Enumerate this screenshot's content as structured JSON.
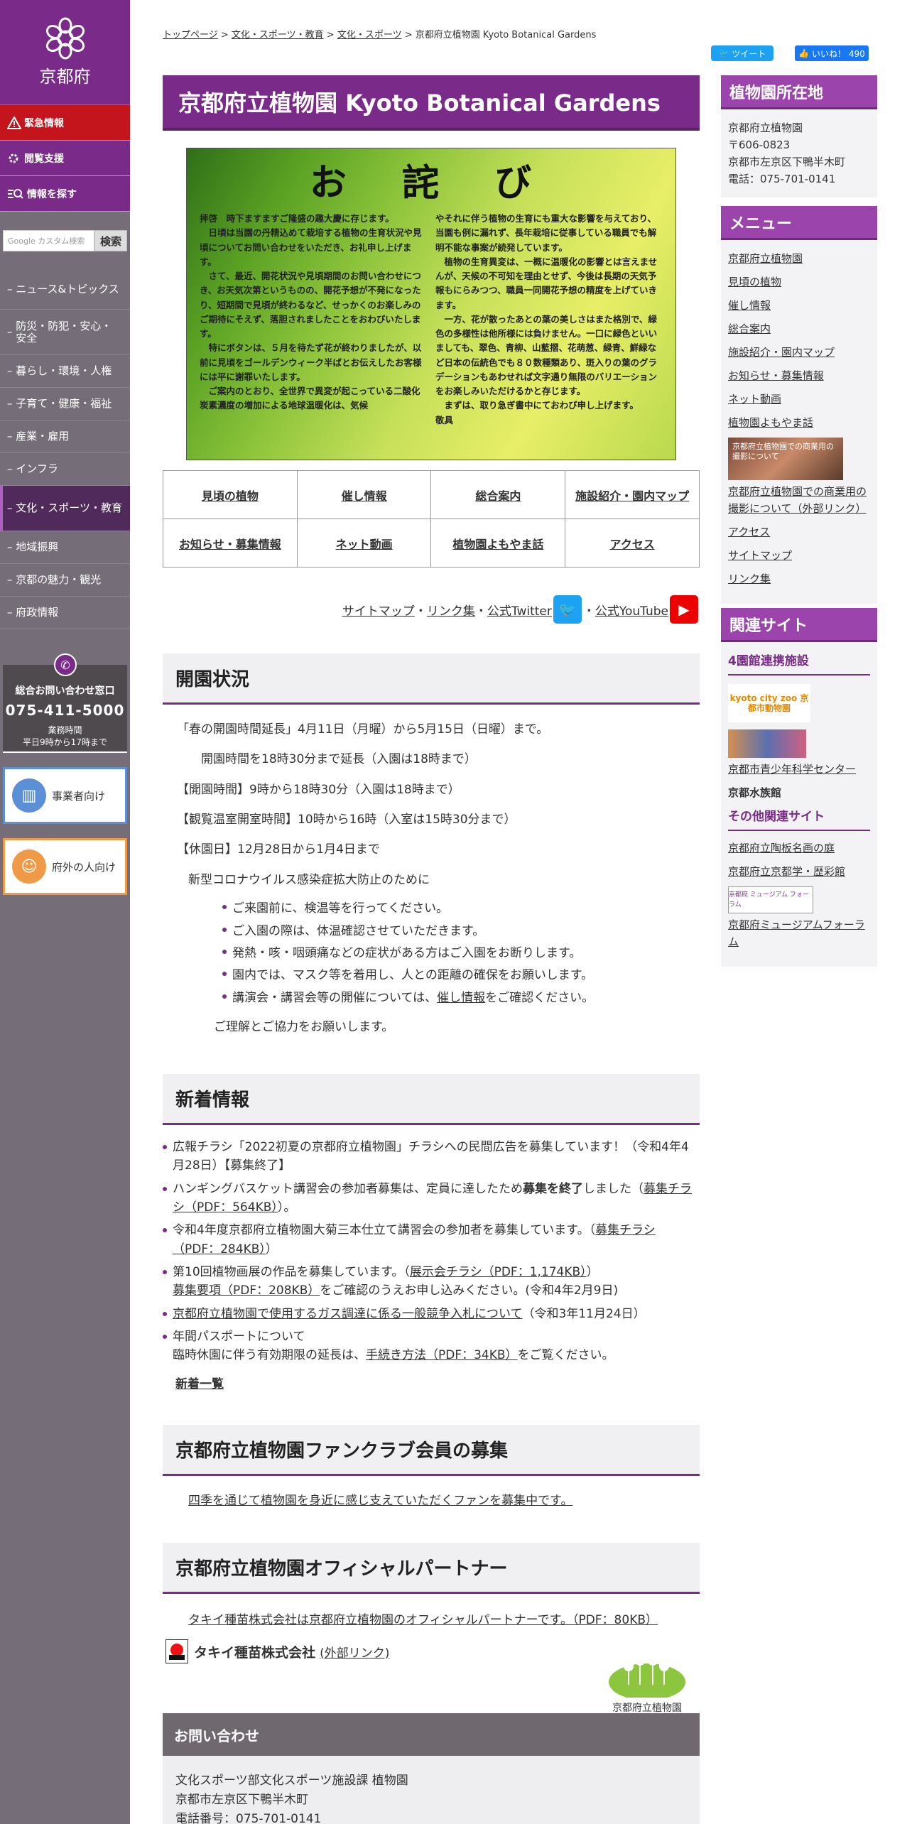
{
  "left": {
    "logo_text": "京都府",
    "emergency": "緊急情報",
    "reading": "閲覧支援",
    "find": "情報を探す",
    "search_placeholder": "Google カスタム検索",
    "search_btn": "検索",
    "nav": [
      "ニュース&トピックス",
      "防災・防犯・安心・安全",
      "暮らし・環境・人権",
      "子育て・健康・福祉",
      "産業・雇用",
      "インフラ",
      "文化・スポーツ・教育",
      "地域振興",
      "京都の魅力・観光",
      "府政情報"
    ],
    "contact": {
      "title": "総合お問い合わせ窓口",
      "phone": "075-411-5000",
      "hours_label": "業務時間",
      "hours": "平日9時から17時まで"
    },
    "card1": "事業者向け",
    "card2": "府外の人向け"
  },
  "breadcrumb": [
    "トップページ",
    "文化・スポーツ・教育",
    "文化・スポーツ",
    "京都府立植物園 Kyoto Botanical Gardens"
  ],
  "social": {
    "tweet": "ツイート",
    "like": "いいね！ 490"
  },
  "title": "京都府立植物園 Kyoto Botanical Gardens",
  "banner": {
    "heading": "お 詫 び",
    "left": "拝啓　時下ますますご隆盛の趣大慶に存じます。\n　日頃は当園の丹精込めて栽培する植物の生育状況や見頃についてお問い合わせをいただき、お礼申し上げます。\n　さて、最近、開花状況や見頃期間のお問い合わせにつき、お天気次第というものの、開花予想が不発になったり、短期間で見頃が終わるなど、せっかくのお楽しみのご期待にそえず、落胆されましたことをおわびいたします。\n　特にボタンは、５月を待たず花が終わりましたが、以前に見頃をゴールデンウィーク半ばとお伝えしたお客様には平に謝罪いたします。\n　ご案内のとおり、全世界で異変が起こっている二酸化炭素濃度の増加による地球温暖化は、気候",
    "right": "やそれに伴う植物の生育にも重大な影響を与えており、当園も例に漏れず、長年栽培に従事している職員でも解明不能な事案が続発しています。\n　植物の生育異変は、一概に温暖化の影響とは言えませんが、天候の不可知を理由とせず、今後は長期の天気予報もにらみつつ、職員一同開花予想の精度を上げていきます。\n　一方、花が散ったあとの葉の美しさはまた格別で、緑色の多様性は他所様には負けません。一口に緑色といいましても、翠色、青柳、山藍摺、花萌葱、緑青、鮮緑など日本の伝統色でも８０数種類あり、斑入りの葉のグラデーションもあわせれば文字通り無限のバリエーションをお楽しみいただけるかと存じます。\n　まずは、取り急ぎ書中にておわび申し上げます。\n敬具"
  },
  "grid": [
    "見頃の植物",
    "催し情報",
    "総合案内",
    "施設紹介・園内マップ",
    "お知らせ・募集情報",
    "ネット動画",
    "植物園よもやま話",
    "アクセス"
  ],
  "links": {
    "sitemap": "サイトマップ",
    "linkshu": "リンク集",
    "twitter": "公式Twitter",
    "youtube": "公式YouTube",
    "dot": "・"
  },
  "open": {
    "heading": "開園状況",
    "p1": "「春の開園時間延長」4月11日（月曜）から5月15日（日曜）まで。",
    "p2": "開園時間を18時30分まで延長（入園は18時まで）",
    "p3": "【開園時間】9時から18時30分（入園は18時まで）",
    "p4": "【観覧温室開室時間】10時から16時（入室は15時30分まで）",
    "p5": "【休園日】12月28日から1月4日まで",
    "p6": "新型コロナウイルス感染症拡大防止のために",
    "bullets": [
      "ご来園前に、検温等を行ってください。",
      "ご入園の際は、体温確認させていただきます。",
      "発熱・咳・咽頭痛などの症状がある方はご入園をお断りします。",
      "園内では、マスク等を着用し、人との距離の確保をお願いします。"
    ],
    "b5a": "講演会・講習会等の開催については、",
    "b5b": "催し情報",
    "b5c": "をご確認ください。",
    "p7": "ご理解とご協力をお願いします。"
  },
  "news": {
    "heading": "新着情報",
    "n1": "広報チラシ「2022初夏の京都府立植物園」チラシへの民間広告を募集しています！（令和4年4月28日）【募集終了】",
    "n2a": "ハンギングバスケット講習会の参加者募集は、定員に達したため",
    "n2b": "募集を終了",
    "n2c": "しました（",
    "n2d": "募集チラシ（PDF：564KB）",
    "n2e": "）。",
    "n3a": "令和4年度京都府立植物園大菊三本仕立て講習会の参加者を募集しています。（",
    "n3b": "募集チラシ（PDF：284KB）",
    "n3c": "）",
    "n4a": "第10回植物画展の作品を募集しています。（",
    "n4b": "展示会チラシ（PDF：1,174KB）",
    "n4c": "）",
    "n4d": "募集要項（PDF：208KB）",
    "n4e": "をご確認のうえお申し込みください。(令和4年2月9日)",
    "n5a": "京都府立植物園で使用するガス調達に係る一般競争入札について",
    "n5b": "（令和3年11月24日）",
    "n6a": "年間パスポートについて",
    "n6b": "臨時休園に伴う有効期限の延長は、",
    "n6c": "手続き方法（PDF：34KB）",
    "n6d": "をご覧ください。",
    "more": "新着一覧"
  },
  "fan": {
    "heading": "京都府立植物園ファンクラブ会員の募集",
    "text": "四季を通じて植物園を身近に感じ支えていただくファンを募集中です。"
  },
  "partner": {
    "heading": "京都府立植物園オフィシャルパートナー",
    "text": "タキイ種苗株式会社は京都府立植物園のオフィシャルパートナーです。（PDF：80KB）",
    "company": "タキイ種苗株式会社",
    "ext": "(外部リンク)",
    "garden_logo": "京都府立植物園"
  },
  "inquiry": {
    "heading": "お問い合わせ",
    "l1": "文化スポーツ部文化スポーツ施設課 植物園",
    "l2": "京都市左京区下鴨半木町",
    "l3": "電話番号：075-701-0141"
  },
  "right": {
    "loc_heading": "植物園所在地",
    "loc": [
      "京都府立植物園",
      "〒606-0823",
      "京都市左京区下鴨半木町",
      "電話：075-701-0141"
    ],
    "menu_heading": "メニュー",
    "menu": [
      "京都府立植物園",
      "見頃の植物",
      "催し情報",
      "総合案内",
      "施設紹介・園内マップ",
      "お知らせ・募集情報",
      "ネット動画",
      "植物園よもやま話"
    ],
    "banner_text": "京都府立植物園での商業用の撮影について",
    "commercial": "京都府立植物園での商業用の撮影について（外部リンク）",
    "menu2": [
      "アクセス",
      "サイトマップ",
      "リンク集"
    ],
    "rel_heading": "関連サイト",
    "sub1": "4園館連携施設",
    "zoo": "kyoto city zoo 京都市動物園",
    "science": "京都市青少年科学センター",
    "aquarium": "京都水族館",
    "sub2": "その他関連サイト",
    "other": [
      "京都府立陶板名画の庭",
      "京都府立京都学・歴彩館"
    ],
    "museum_logo": "京都府 ミュージアム フォーラム",
    "museum": "京都府ミュージアムフォーラム"
  },
  "colors": {
    "purple": "#7a2a88",
    "red": "#c4151c",
    "twitter": "#1da1f2",
    "youtube": "#e00"
  }
}
